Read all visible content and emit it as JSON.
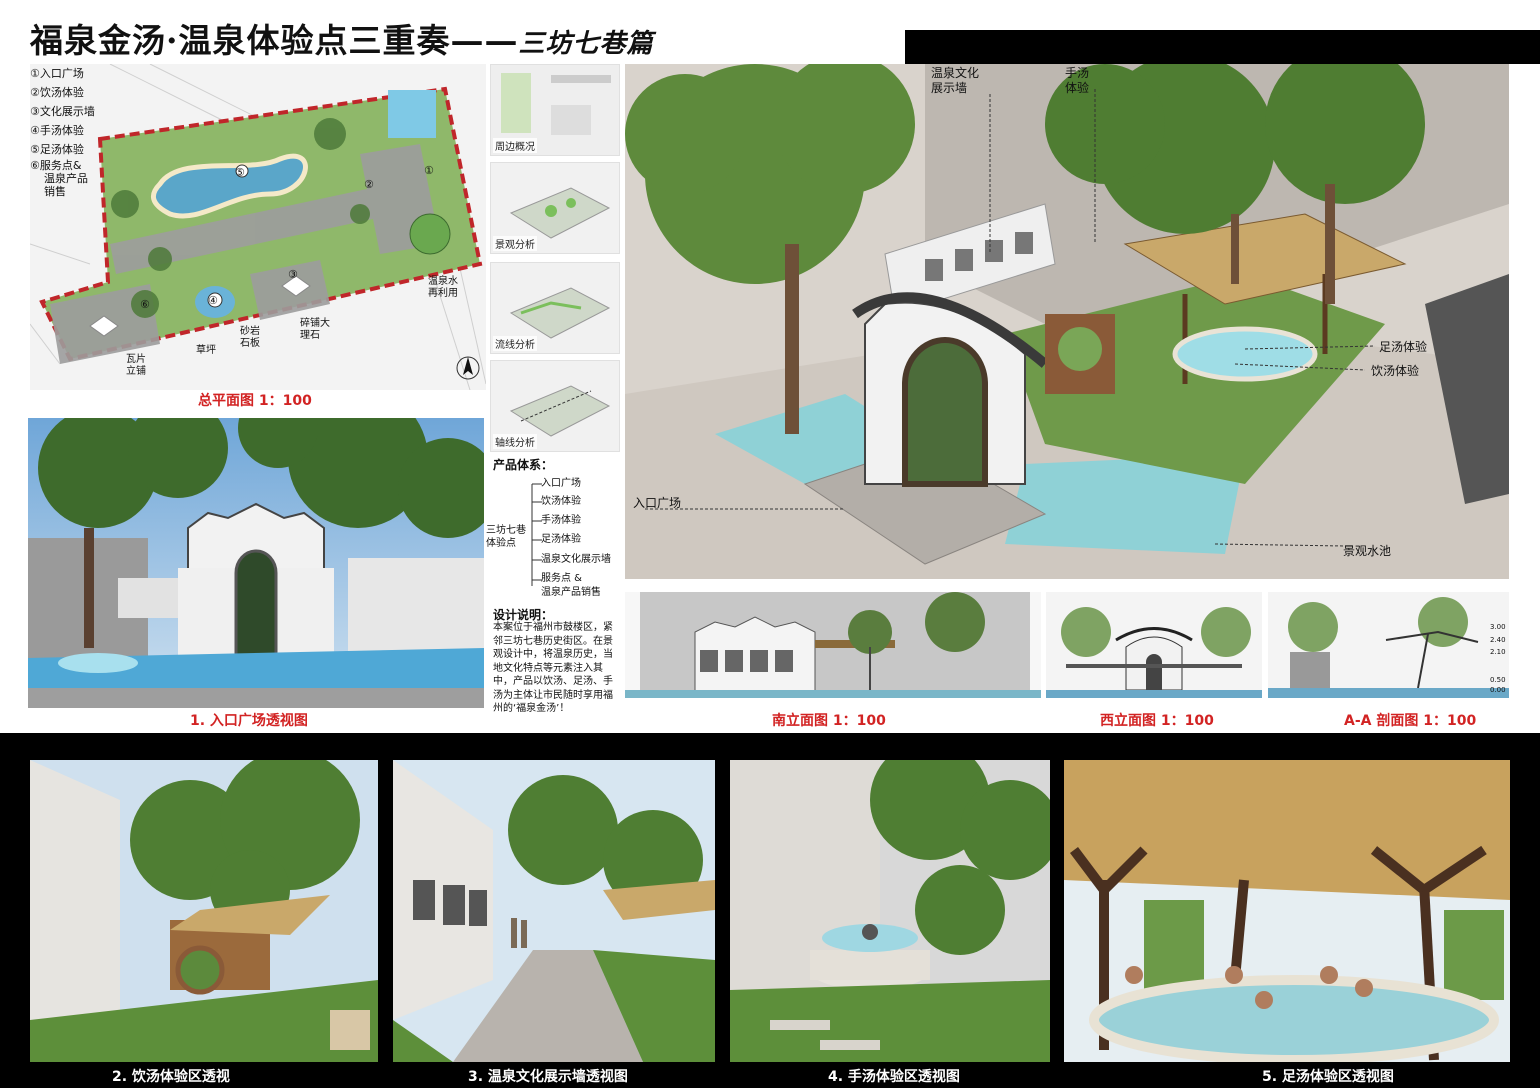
{
  "title": {
    "main": "福泉金汤·温泉体验点三重奏——",
    "sub": "三坊七巷篇"
  },
  "legend": [
    "①入口广场",
    "②饮汤体验",
    "③文化展示墙",
    "④手汤体验",
    "⑤足汤体验",
    "⑥服务点&",
    "温泉产品",
    "销售"
  ],
  "plan": {
    "caption": "总平面图 1：100",
    "labels": {
      "tile": "瓦片\n立铺",
      "grass": "草坪",
      "stone": "砂岩\n石板",
      "marble": "碎铺大\n理石",
      "recycle": "温泉水\n再利用",
      "north": "N"
    }
  },
  "analysis": [
    {
      "label": "周边概况"
    },
    {
      "label": "景观分析"
    },
    {
      "label": "流线分析"
    },
    {
      "label": "轴线分析"
    }
  ],
  "product": {
    "title": "产品体系：",
    "root": "三坊七巷体验点",
    "items": [
      "入口广场",
      "饮汤体验",
      "手汤体验",
      "足汤体验",
      "温泉文化展示墙",
      "服务点 &",
      "温泉产品销售"
    ]
  },
  "design": {
    "title": "设计说明：",
    "body": "本案位于福州市鼓楼区，紧邻三坊七巷历史街区。在景观设计中，将温泉历史，当地文化特点等元素注入其中，产品以饮汤、足汤、手汤为主体让市民随时享用福州的‘福泉金汤’！"
  },
  "main_view": {
    "labels": {
      "wall": "温泉文化\n展示墙",
      "hand": "手汤\n体验",
      "foot": "足汤体验",
      "drink": "饮汤体验",
      "entrance": "入口广场",
      "pool": "景观水池"
    }
  },
  "captions": {
    "entrance_view": "1. 入口广场透视图",
    "south": "南立面图 1：100",
    "west": "西立面图 1：100",
    "section": "A-A 剖面图 1：100",
    "drink": "2. 饮汤体验区透视",
    "wall": "3. 温泉文化展示墙透视图",
    "hand": "4. 手汤体验区透视图",
    "foot": "5. 足汤体验区透视图"
  },
  "section_marks": [
    "3.00",
    "2.40",
    "2.10",
    "0.50",
    "0.00"
  ],
  "colors": {
    "accent_red": "#d22323",
    "water": "#7ecfd8",
    "grass": "#6aa84f",
    "paving": "#9a9a9a",
    "wall_white": "#f2f2f2",
    "brick": "#b8b4ae"
  }
}
